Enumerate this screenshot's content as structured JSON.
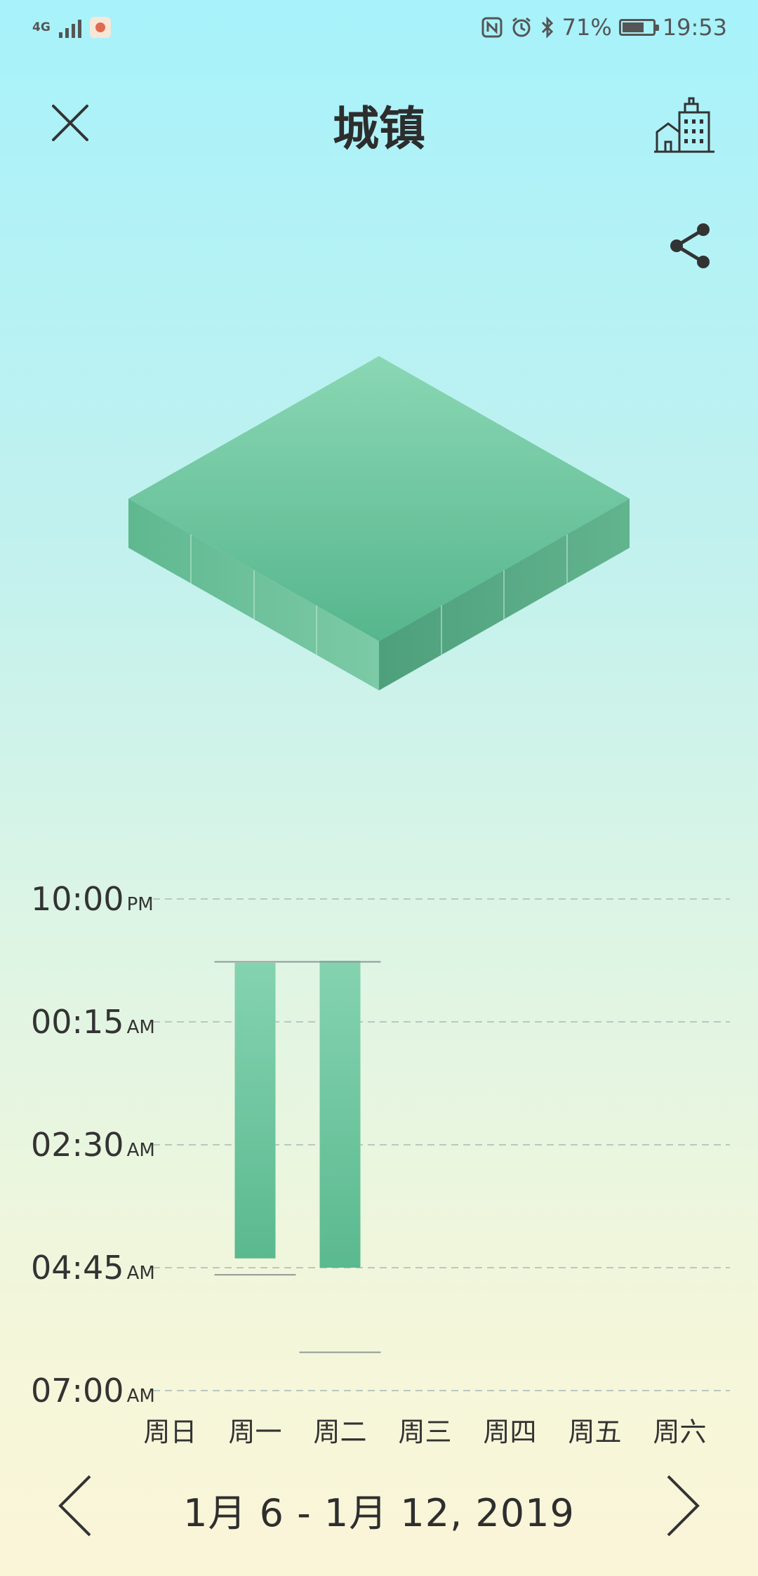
{
  "status_bar": {
    "network": "4G",
    "battery_percent": "71%",
    "battery_level": 0.71,
    "time": "19:53",
    "icons": [
      "signal-icon",
      "app-notification-icon",
      "nfc-icon",
      "alarm-icon",
      "bluetooth-icon",
      "battery-icon"
    ]
  },
  "header": {
    "title": "城镇",
    "close_icon": "close-icon",
    "city_icon": "city-buildings-icon",
    "share_icon": "share-icon"
  },
  "colors": {
    "accent": "#5cbf95",
    "bar_top": "#84d3b0",
    "bar_bottom": "#5bb98f",
    "grid": "#b9c8c0"
  },
  "chart_data": {
    "type": "bar",
    "orientation": "floating-range",
    "y_tick_labels": [
      {
        "time": "10:00",
        "ampm": "PM"
      },
      {
        "time": "00:15",
        "ampm": "AM"
      },
      {
        "time": "02:30",
        "ampm": "AM"
      },
      {
        "time": "04:45",
        "ampm": "AM"
      },
      {
        "time": "07:00",
        "ampm": "AM"
      }
    ],
    "y_ticks_hours": [
      0,
      2.25,
      4.5,
      6.75,
      9
    ],
    "ylim_hours_since_10pm": [
      0,
      9
    ],
    "categories": [
      "周日",
      "周一",
      "周二",
      "周三",
      "周四",
      "周五",
      "周六"
    ],
    "bars": [
      {
        "day": "周一",
        "start": "11:10 PM",
        "end": "04:35 AM"
      },
      {
        "day": "周二",
        "start": "11:08 PM",
        "end": "04:45 AM"
      }
    ],
    "bars_hours": [
      {
        "index": 1,
        "start": 1.17,
        "end": 6.58
      },
      {
        "index": 2,
        "start": 1.13,
        "end": 6.75
      }
    ],
    "reference_lines": [
      {
        "label": "bedtime-average",
        "value": 1.15,
        "from_index": 1,
        "to_index": 2
      },
      {
        "label": "wake-line",
        "value": 6.88,
        "from_index": 1,
        "to_index": 1
      },
      {
        "label": "wake-line",
        "value": 8.3,
        "from_index": 2,
        "to_index": 2
      }
    ]
  },
  "date_range": {
    "label": "1月 6  - 1月 12, 2019",
    "prev_icon": "chevron-left-icon",
    "next_icon": "chevron-right-icon"
  }
}
